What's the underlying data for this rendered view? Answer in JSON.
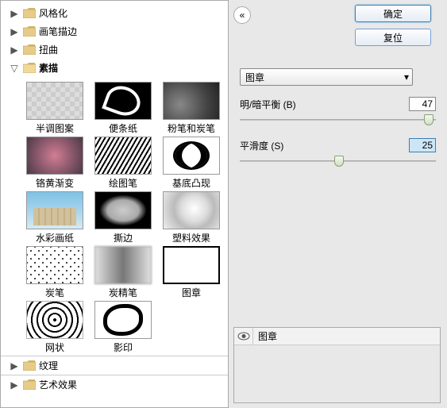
{
  "tree": {
    "top": [
      {
        "label": "风格化",
        "expanded": false
      },
      {
        "label": "画笔描边",
        "expanded": false
      },
      {
        "label": "扭曲",
        "expanded": false
      },
      {
        "label": "素描",
        "expanded": true
      }
    ],
    "bottom": [
      {
        "label": "纹理",
        "expanded": false
      },
      {
        "label": "艺术效果",
        "expanded": false
      }
    ]
  },
  "thumbs": [
    {
      "label": "半调图案",
      "style": "checker"
    },
    {
      "label": "便条纸",
      "style": "swirl-w"
    },
    {
      "label": "粉笔和炭笔",
      "style": "cloud-g"
    },
    {
      "label": "铬黄渐变",
      "style": "abstract-r"
    },
    {
      "label": "绘图笔",
      "style": "hatch"
    },
    {
      "label": "基底凸现",
      "style": "loops"
    },
    {
      "label": "水彩画纸",
      "style": "sky-img"
    },
    {
      "label": "撕边",
      "style": "torn"
    },
    {
      "label": "塑料效果",
      "style": "blob"
    },
    {
      "label": "炭笔",
      "style": "grain"
    },
    {
      "label": "炭精笔",
      "style": "charblur"
    },
    {
      "label": "图章",
      "style": "stamp-bw",
      "selected": true
    },
    {
      "label": "网状",
      "style": "netlike"
    },
    {
      "label": "影印",
      "style": "swirl-wb"
    }
  ],
  "buttons": {
    "ok": "确定",
    "reset": "复位"
  },
  "dropdown": {
    "selected": "图章"
  },
  "sliders": [
    {
      "label": "明/暗平衡 (B)",
      "value": "47",
      "pos": 94
    },
    {
      "label": "平滑度 (S)",
      "value": "25",
      "pos": 48,
      "highlight": true
    }
  ],
  "layers": [
    {
      "name": "图章",
      "visible": true
    }
  ],
  "icons": {
    "collapse": "«",
    "dropdown_arrow": "▾",
    "tree_right": "▶",
    "tree_down": "▽"
  }
}
